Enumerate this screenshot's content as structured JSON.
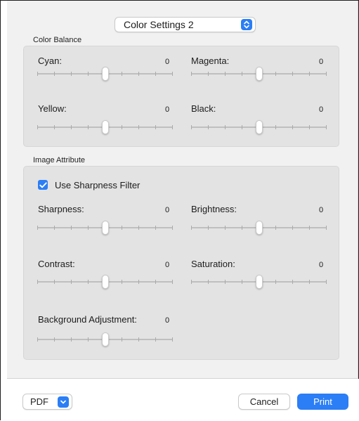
{
  "popup": {
    "label": "Color Settings 2",
    "icon": "chevron-up-down-icon"
  },
  "color_balance": {
    "title": "Color Balance",
    "sliders": [
      {
        "label": "Cyan:",
        "value": "0"
      },
      {
        "label": "Magenta:",
        "value": "0"
      },
      {
        "label": "Yellow:",
        "value": "0"
      },
      {
        "label": "Black:",
        "value": "0"
      }
    ]
  },
  "image_attribute": {
    "title": "Image Attribute",
    "sharpness_filter": {
      "label": "Use Sharpness Filter",
      "checked": true
    },
    "sliders": [
      {
        "label": "Sharpness:",
        "value": "0"
      },
      {
        "label": "Brightness:",
        "value": "0"
      },
      {
        "label": "Contrast:",
        "value": "0"
      },
      {
        "label": "Saturation:",
        "value": "0"
      },
      {
        "label": "Background Adjustment:",
        "value": "0"
      }
    ]
  },
  "footer": {
    "pdf_label": "PDF",
    "cancel_label": "Cancel",
    "print_label": "Print"
  },
  "colors": {
    "accent": "#2b7ef5",
    "panel": "#f1f1f1",
    "group": "#e3e3e3"
  }
}
